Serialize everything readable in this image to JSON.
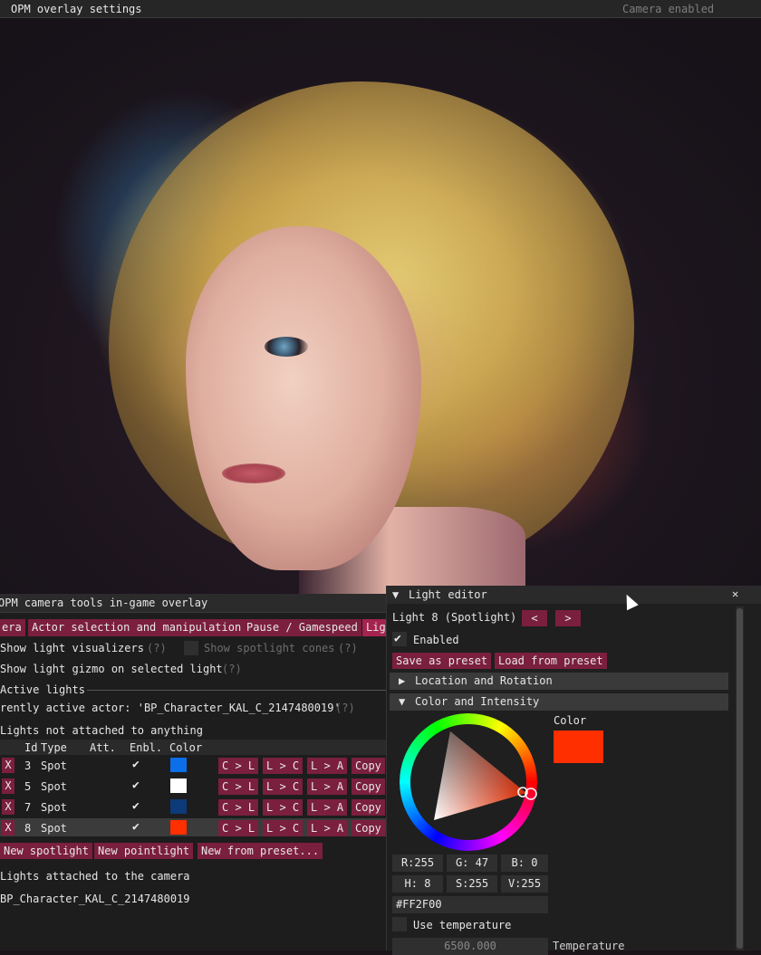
{
  "top_bar": {
    "title": "OPM overlay settings",
    "status": "Camera enabled"
  },
  "main_window": {
    "title": "OPM camera tools in-game overlay",
    "tabs": [
      {
        "label": "era"
      },
      {
        "label": "Actor selection and manipulation"
      },
      {
        "label": "Pause / Gamespeed"
      },
      {
        "label": "Lig"
      }
    ],
    "show_light_visualizers": "Show light visualizers",
    "help": "(?)",
    "show_spotlight_cones": "Show spotlight cones",
    "show_light_gizmo": "Show light gizmo on selected light",
    "active_lights": "Active lights",
    "currently_active_actor": "rently active actor: 'BP_Character_KAL_C_2147480019'",
    "not_attached": "Lights not attached to anything",
    "table_headers": {
      "id": "Id",
      "type": "Type",
      "att": "Att.",
      "enbl": "Enbl.",
      "color": "Color"
    },
    "rows": [
      {
        "id": "3",
        "type": "Spot",
        "color": "#0a6fe8"
      },
      {
        "id": "5",
        "type": "Spot",
        "color": "#ffffff"
      },
      {
        "id": "7",
        "type": "Spot",
        "color": "#0d3a78"
      },
      {
        "id": "8",
        "type": "Spot",
        "color": "#ff2f00"
      }
    ],
    "row_buttons": {
      "x": "X",
      "check": "✔",
      "cl": "C > L",
      "lc": "L > C",
      "la": "L > A",
      "copy": "Copy"
    },
    "new_spotlight": "New spotlight",
    "new_pointlight": "New pointlight",
    "new_from_preset": "New from preset...",
    "attached_to_camera": "Lights attached to the camera",
    "actor_name": "BP_Character_KAL_C_2147480019"
  },
  "light_editor": {
    "title": "Light editor",
    "close": "✕",
    "light_name": "Light 8 (Spotlight)",
    "prev": "<",
    "next": ">",
    "enabled": "Enabled",
    "save_preset": "Save as preset",
    "load_preset": "Load from preset",
    "section_location": "Location and Rotation",
    "section_color": "Color and Intensity",
    "color_label": "Color",
    "color_value": "#ff2f00",
    "r": "R:255",
    "g": "G: 47",
    "b": "B:  0",
    "h": "H:  8",
    "s": "S:255",
    "v": "V:255",
    "hex": "#FF2F00",
    "use_temperature": "Use temperature",
    "temperature_value": "6500.000",
    "temperature_label": "Temperature"
  }
}
